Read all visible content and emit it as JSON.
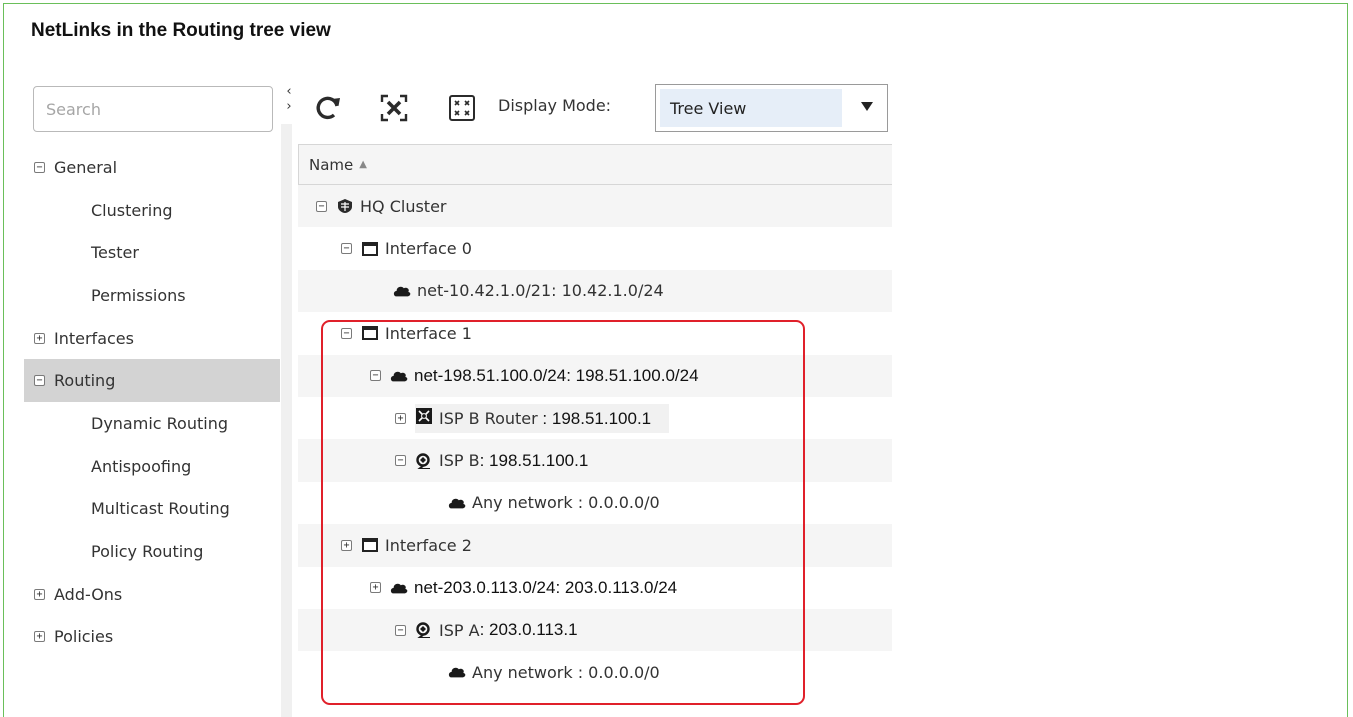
{
  "figure_title": "NetLinks in the Routing tree view",
  "search": {
    "placeholder": "Search"
  },
  "nav": {
    "general": "General",
    "clustering": "Clustering",
    "tester": "Tester",
    "permissions": "Permissions",
    "interfaces": "Interfaces",
    "routing": "Routing",
    "dynamic_routing": "Dynamic Routing",
    "antispoofing": "Antispoofing",
    "multicast_routing": "Multicast Routing",
    "policy_routing": "Policy Routing",
    "add_ons": "Add-Ons",
    "policies": "Policies"
  },
  "toolbar": {
    "display_mode_label": "Display Mode:",
    "display_mode_value": "Tree View"
  },
  "table": {
    "column_name": "Name",
    "rows": {
      "hq_cluster": "HQ Cluster",
      "interface0": "Interface 0",
      "net_10_name": "net-10.42.1.0/21",
      "net_10_addr": " : 10.42.1.0/24",
      "interface1": "Interface 1",
      "net_198_name": "net-198.51.100.0/24",
      "net_198_addr": " : 198.51.100.0/24",
      "isp_b_router_name": "ISP B Router",
      "isp_b_router_addr": " : 198.51.100.1",
      "isp_b_name": "ISP B",
      "isp_b_addr": " : 198.51.100.1",
      "any_network_1": "Any network : 0.0.0.0/0",
      "interface2": "Interface 2",
      "net_203_name": "net-203.0.113.0/24",
      "net_203_addr": " : 203.0.113.0/24",
      "isp_a_name": "ISP A",
      "isp_a_addr": " : 203.0.113.1",
      "any_network_2": "Any network : 0.0.0.0/0"
    }
  },
  "colors": {
    "frame": "#6abf5a",
    "highlight": "#e0202a",
    "selected_row": "#d3d3d3"
  },
  "icons": [
    "refresh-icon",
    "fit-to-view-icon",
    "expand-all-icon",
    "firewall-cluster-icon",
    "interface-icon",
    "network-cloud-icon",
    "router-icon",
    "netlink-icon"
  ]
}
